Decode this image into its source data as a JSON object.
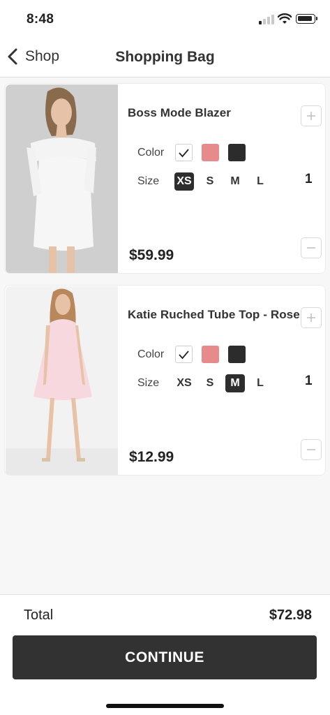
{
  "status": {
    "time": "8:48"
  },
  "nav": {
    "back_label": "Shop",
    "title": "Shopping Bag"
  },
  "labels": {
    "color": "Color",
    "size": "Size"
  },
  "sizes": [
    "XS",
    "S",
    "M",
    "L"
  ],
  "colors": {
    "pink": "#e78a8c",
    "dark": "#2c2c2c",
    "accent": "#323232"
  },
  "items": [
    {
      "name": "Boss Mode Blazer",
      "price": "$59.99",
      "qty": "1",
      "selected_size": "XS",
      "selected_color": "white"
    },
    {
      "name": "Katie Ruched Tube Top - Rose",
      "price": "$12.99",
      "qty": "1",
      "selected_size": "M",
      "selected_color": "white"
    }
  ],
  "footer": {
    "total_label": "Total",
    "total_value": "$72.98",
    "cta": "CONTINUE"
  }
}
